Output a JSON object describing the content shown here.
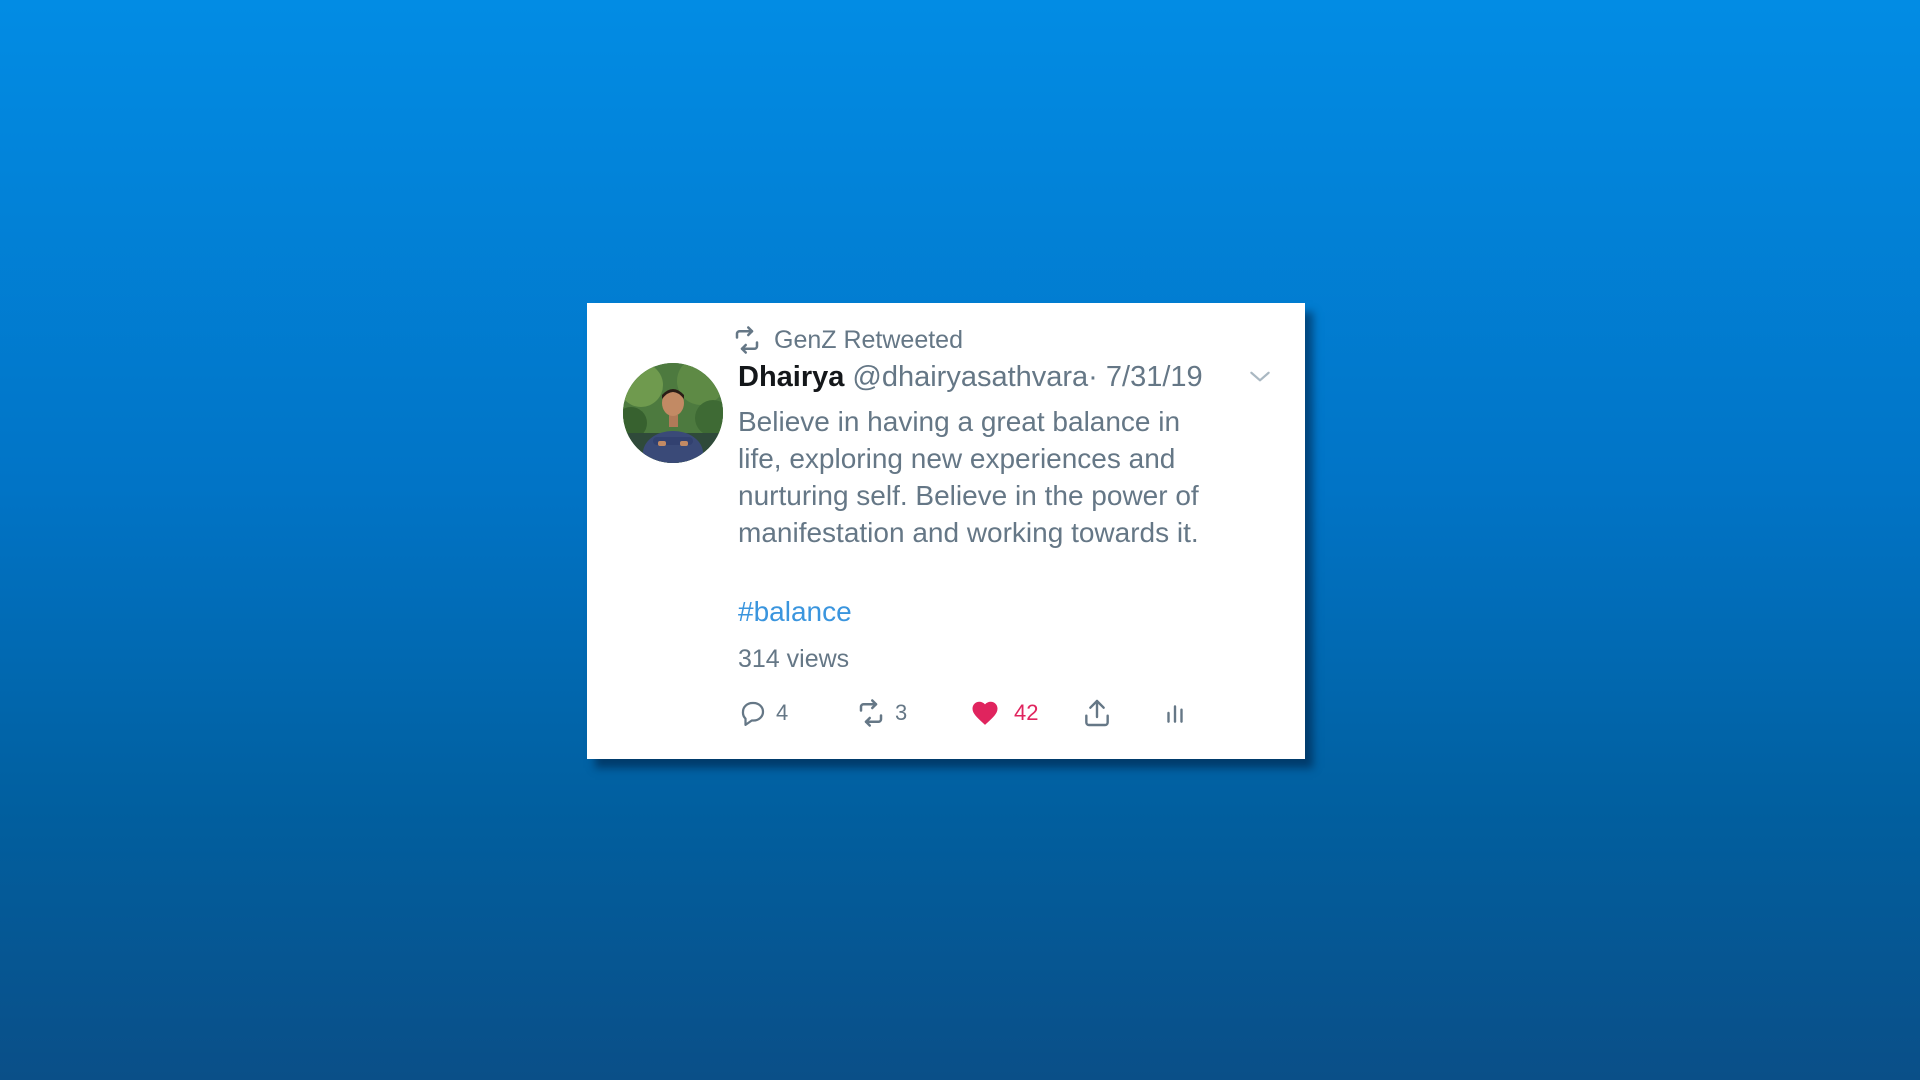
{
  "retweet": {
    "label": "GenZ Retweeted",
    "icon": "retweet-icon"
  },
  "tweet": {
    "author_name": "Dhairya",
    "handle": "@dhairyasathvara",
    "date": "· 7/31/19",
    "text": "Believe in having a great balance in life, exploring new experiences and nurturing self. Believe in the power of manifestation and working towards it.",
    "hashtag": "#balance",
    "views": "314 views"
  },
  "actions": {
    "reply": {
      "icon": "reply-icon",
      "count": "4"
    },
    "retweet": {
      "icon": "retweet-icon",
      "count": "3"
    },
    "like": {
      "icon": "heart-icon",
      "count": "42",
      "color": "#e0245e"
    },
    "share": {
      "icon": "share-icon"
    },
    "analytics": {
      "icon": "analytics-icon"
    }
  },
  "colors": {
    "background_top": "#028ce4",
    "background_bottom": "#0a4f88",
    "text_secondary": "#657786",
    "hashtag": "#3a95de",
    "like": "#e0245e"
  }
}
